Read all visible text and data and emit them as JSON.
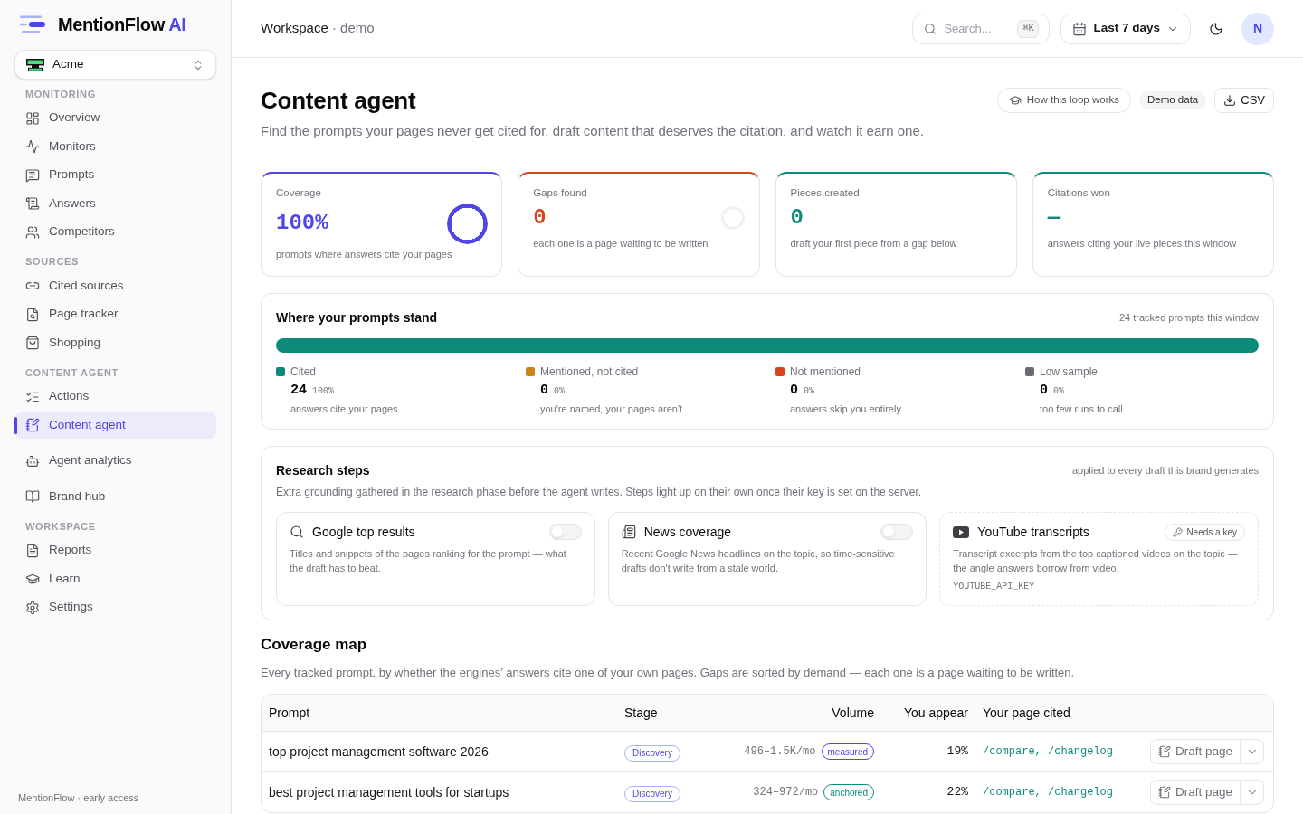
{
  "sidebar": {
    "brand": {
      "name": "MentionFlow",
      "suffix": "AI"
    },
    "workspace_switcher": {
      "value": "Acme"
    },
    "sections": [
      {
        "heading": "MONITORING",
        "items": [
          {
            "label": "Overview",
            "selected": false
          },
          {
            "label": "Monitors",
            "selected": false
          },
          {
            "label": "Prompts",
            "selected": false
          },
          {
            "label": "Answers",
            "selected": false
          },
          {
            "label": "Competitors",
            "selected": false
          }
        ]
      },
      {
        "heading": "SOURCES",
        "items": [
          {
            "label": "Cited sources",
            "selected": false
          },
          {
            "label": "Page tracker",
            "selected": false
          },
          {
            "label": "Shopping",
            "selected": false
          }
        ]
      },
      {
        "heading": "CONTENT AGENT",
        "items": [
          {
            "label": "Actions",
            "selected": false
          },
          {
            "label": "Content agent",
            "selected": true
          },
          {
            "label": "Agent analytics",
            "selected": false
          },
          {
            "label": "Brand hub",
            "selected": false
          }
        ]
      },
      {
        "heading": "WORKSPACE",
        "items": [
          {
            "label": "Reports",
            "selected": false
          },
          {
            "label": "Learn",
            "selected": false
          },
          {
            "label": "Settings",
            "selected": false
          }
        ]
      }
    ],
    "footer": "MentionFlow · early access"
  },
  "header": {
    "breadcrumb": {
      "workspace": "Workspace",
      "project": "· demo"
    },
    "search": {
      "placeholder": "Search...",
      "shortcut": "⌘K"
    },
    "date_range": {
      "value": "Last 7 days"
    },
    "avatar": {
      "initial": "N"
    }
  },
  "page": {
    "title": "Content agent",
    "subtitle": "Find the prompts your pages never get cited for, draft content that deserves the citation, and watch it earn one.",
    "actions": [
      {
        "kind": "guide",
        "label": "How this loop works"
      },
      {
        "kind": "tag",
        "label": "Demo data"
      },
      {
        "kind": "download",
        "label": "CSV"
      }
    ]
  },
  "stats": [
    {
      "label": "Coverage",
      "value": "100%",
      "description": "prompts where answers cite your pages",
      "color": "#4f46e5",
      "level": 1
    },
    {
      "label": "Gaps found",
      "value": "0",
      "description": "each one is a page waiting to be written",
      "color": "#d9431e"
    },
    {
      "label": "Pieces created",
      "value": "0",
      "description": "draft your first piece from a gap below",
      "color": "#0e8a7b"
    },
    {
      "label": "Citations won",
      "value": "—",
      "description": "answers citing your live pieces this window",
      "color": "#0e8a7b"
    }
  ],
  "prompt_standing": {
    "title": "Where your prompts stand",
    "note": "24 tracked prompts this window",
    "segments": [
      {
        "label": "Cited",
        "count": "24",
        "share": "100%",
        "description": "answers cite your pages",
        "color": "#0e8a7b",
        "level": 1
      },
      {
        "label": "Mentioned, not cited",
        "count": "0",
        "share": "0%",
        "description": "you're named, your pages aren't",
        "color": "#c98512",
        "level": 0
      },
      {
        "label": "Not mentioned",
        "count": "0",
        "share": "0%",
        "description": "answers skip you entirely",
        "color": "#d9431e",
        "level": 0
      },
      {
        "label": "Low sample",
        "count": "0",
        "share": "0%",
        "description": "too few runs to call",
        "color": "#6b6b73",
        "level": 0
      }
    ]
  },
  "research_steps": {
    "title": "Research steps",
    "note": "applied to every draft this brand generates",
    "description": "Extra grounding gathered in the research phase before the agent writes. Steps light up on their own once their key is set on the server.",
    "steps": [
      {
        "kind": "toggle",
        "title": "Google top results",
        "description": "Titles and snippets of the pages ranking for the prompt — what the draft has to beat.",
        "on": false
      },
      {
        "kind": "toggle",
        "title": "News coverage",
        "description": "Recent Google News headlines on the topic, so time-sensitive drafts don't write from a stale world.",
        "on": false
      },
      {
        "kind": "key_required",
        "title": "YouTube transcripts",
        "description": "Transcript excerpts from the top captioned videos on the topic — the angle answers borrow from video.",
        "badge": "Needs a key",
        "env_key": "YOUTUBE_API_KEY"
      }
    ]
  },
  "coverage_map": {
    "title": "Coverage map",
    "description": "Every tracked prompt, by whether the engines’ answers cite one of your own pages. Gaps are sorted by demand — each one is a page waiting to be written.",
    "columns": [
      "Prompt",
      "Stage",
      "Volume",
      "You appear",
      "Your page cited"
    ],
    "rows": [
      {
        "prompt": "top project management software 2026",
        "stage": "Discovery",
        "volume": "496–1.5K/mo",
        "volume_tag": {
          "label": "measured",
          "color": "#4f46e5"
        },
        "appear": "19%",
        "pages": "/compare, /changelog",
        "action": "Draft page"
      },
      {
        "prompt": "best project management tools for startups",
        "stage": "Discovery",
        "volume": "324–972/mo",
        "volume_tag": {
          "label": "anchored",
          "color": "#0e8a7b"
        },
        "appear": "22%",
        "pages": "/compare, /changelog",
        "action": "Draft page"
      }
    ]
  }
}
